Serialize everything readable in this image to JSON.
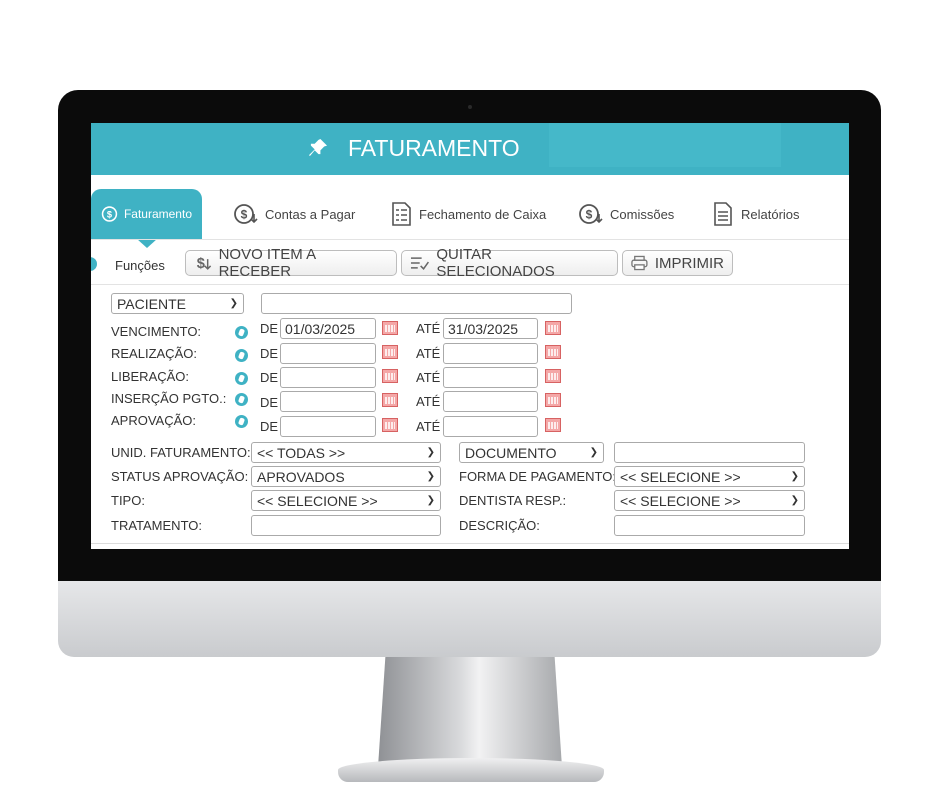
{
  "header": {
    "title": "FATURAMENTO",
    "icon": "pin-icon",
    "color": "#3fb2c4"
  },
  "tabs": [
    {
      "label": "Faturamento",
      "icon": "dollar-circle-icon",
      "active": true
    },
    {
      "label": "Contas a Pagar",
      "icon": "dollar-circle-down-icon"
    },
    {
      "label": "Fechamento de Caixa",
      "icon": "document-list-icon"
    },
    {
      "label": "Comissões",
      "icon": "dollar-circle-down-icon"
    },
    {
      "label": "Relatórios",
      "icon": "report-icon"
    }
  ],
  "toolbar": {
    "funcoes": "Funções",
    "novo_item": "NOVO ITEM A RECEBER",
    "quitar": "QUITAR SELECIONADOS",
    "imprimir": "IMPRIMIR"
  },
  "filters": {
    "search_type": "PACIENTE",
    "search_value": "",
    "de_label": "DE",
    "ate_label": "ATÉ",
    "dates": [
      {
        "label": "VENCIMENTO:",
        "de": "01/03/2025",
        "ate": "31/03/2025"
      },
      {
        "label": "REALIZAÇÃO:",
        "de": "",
        "ate": ""
      },
      {
        "label": "LIBERAÇÃO:",
        "de": "",
        "ate": ""
      },
      {
        "label": "INSERÇÃO PGTO.:",
        "de": "",
        "ate": ""
      },
      {
        "label": "APROVAÇÃO:",
        "de": "",
        "ate": ""
      }
    ],
    "unid_label": "UNID. FATURAMENTO:",
    "unid_value": "<< TODAS >>",
    "documento_select": "DOCUMENTO",
    "documento_value": "",
    "status_label": "STATUS APROVAÇÃO:",
    "status_value": "APROVADOS",
    "forma_label": "FORMA DE PAGAMENTO:",
    "forma_value": "<< SELECIONE >>",
    "tipo_label": "TIPO:",
    "tipo_value": "<< SELECIONE >>",
    "dentista_label": "DENTISTA RESP.:",
    "dentista_value": "<< SELECIONE >>",
    "tratamento_label": "TRATAMENTO:",
    "tratamento_value": "",
    "descricao_label": "DESCRIÇÃO:",
    "descricao_value": ""
  }
}
